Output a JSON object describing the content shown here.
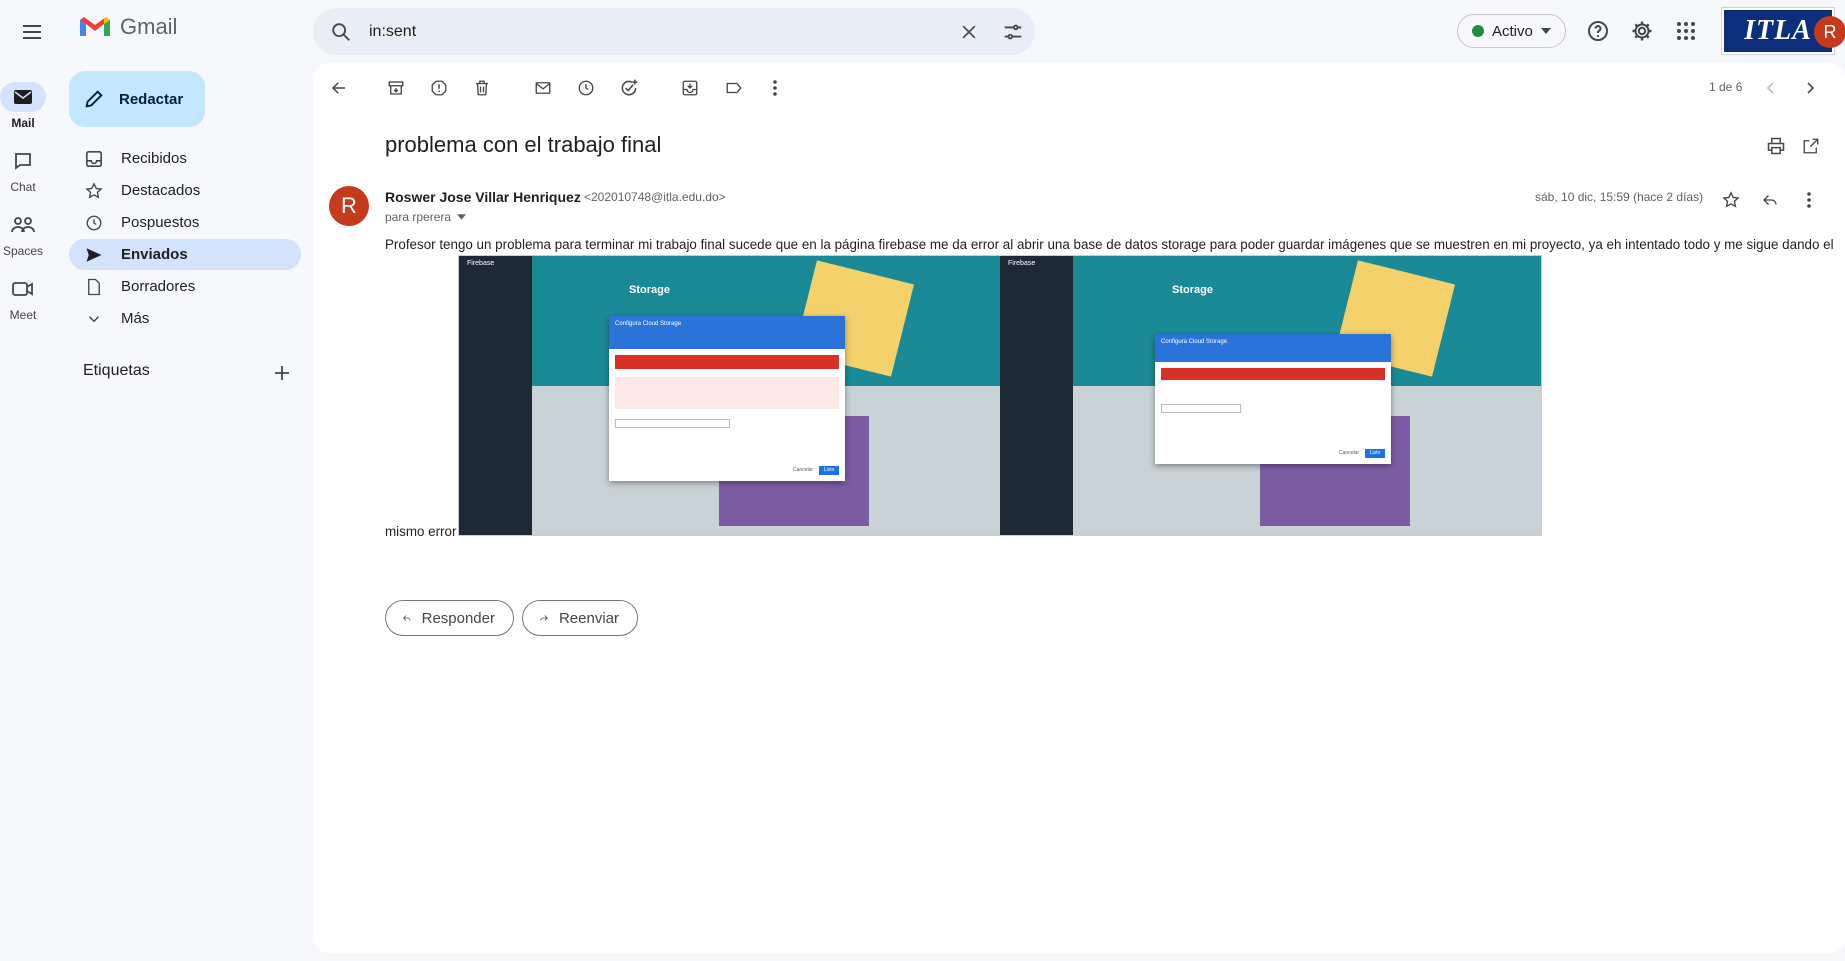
{
  "app": {
    "name": "Gmail"
  },
  "search": {
    "value": "in:sent"
  },
  "status": {
    "label": "Activo"
  },
  "org_logo": {
    "text": "ITLA"
  },
  "account": {
    "initial": "R"
  },
  "rail": [
    {
      "label": "Mail"
    },
    {
      "label": "Chat"
    },
    {
      "label": "Spaces"
    },
    {
      "label": "Meet"
    }
  ],
  "compose": {
    "label": "Redactar"
  },
  "nav": [
    {
      "label": "Recibidos"
    },
    {
      "label": "Destacados"
    },
    {
      "label": "Pospuestos"
    },
    {
      "label": "Enviados"
    },
    {
      "label": "Borradores"
    },
    {
      "label": "Más"
    }
  ],
  "labels": {
    "heading": "Etiquetas"
  },
  "toolbar": {
    "pager": "1 de 6"
  },
  "message": {
    "subject": "problema con el trabajo final",
    "sender_initial": "R",
    "sender_name": "Roswer Jose Villar Henriquez",
    "sender_email": "<202010748@itla.edu.do>",
    "recipient": "para rperera",
    "date": "sáb, 10 dic, 15:59 (hace 2 días)",
    "body_line1": "Profesor tengo un problema para terminar mi trabajo final sucede que en la página firebase me da error al abrir una base de datos storage para poder guardar imágenes que se muestren en mi proyecto, ya eh intentado todo y me sigue dando el",
    "body_line2": "mismo error"
  },
  "screenshot": {
    "app": "Firebase",
    "page_title": "Storage",
    "dialog_title": "Configura Cloud Storage",
    "cancel": "Cancelar",
    "done": "Listo"
  },
  "actions": {
    "reply": "Responder",
    "forward": "Reenviar"
  },
  "colors": {
    "accent": "#0b57d0",
    "avatar": "#c5391d",
    "active_nav": "#d3e3fd",
    "compose": "#c2e7ff"
  }
}
